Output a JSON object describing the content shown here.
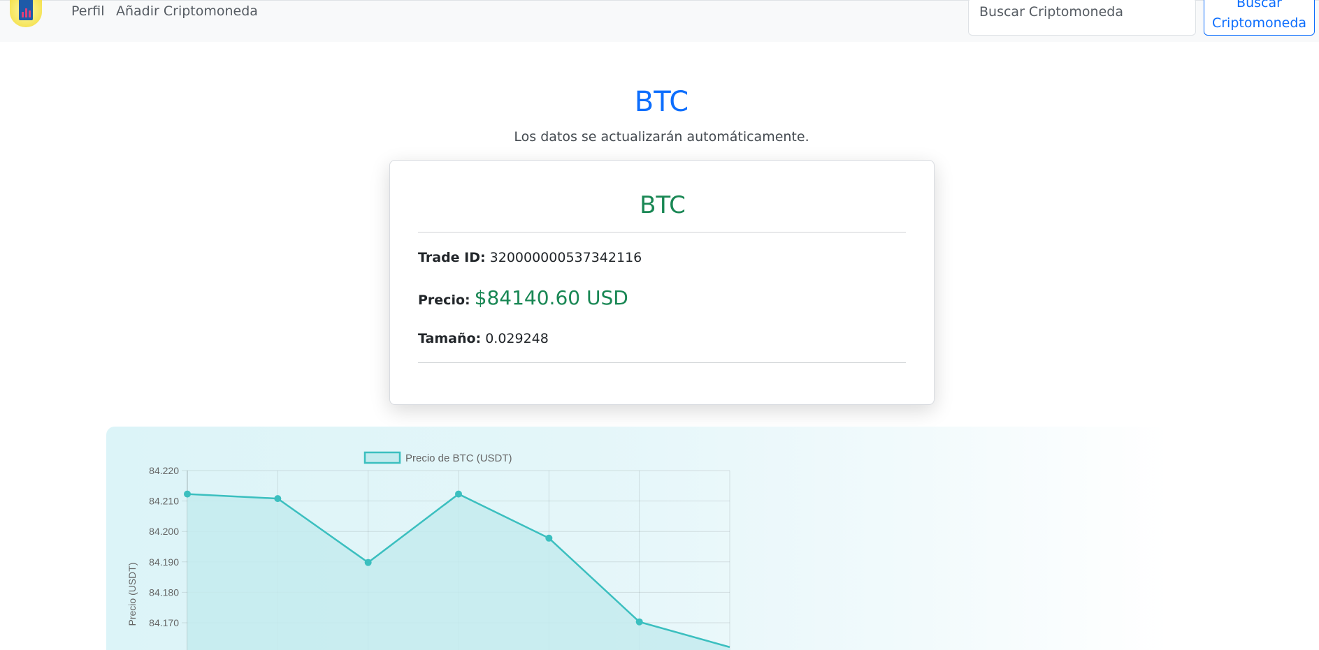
{
  "navbar": {
    "links": [
      "Perfil",
      "Añadir Criptomoneda"
    ],
    "search_placeholder": "Buscar Criptomoneda",
    "search_button": "Buscar Criptomoneda"
  },
  "header": {
    "title": "BTC",
    "subtitle": "Los datos se actualizarán automáticamente."
  },
  "card": {
    "symbol": "BTC",
    "trade_id_label": "Trade ID:",
    "trade_id": "320000000537342116",
    "price_label": "Precio:",
    "price": "$84140.60 USD",
    "size_label": "Tamaño:",
    "size": "0.029248"
  },
  "colors": {
    "primary": "#0d6efd",
    "success": "#198754",
    "chart_line": "#3bbfbf",
    "chart_fill": "#c4ebee"
  },
  "chart_data": {
    "type": "line",
    "legend": "Precio de BTC (USDT)",
    "legend_position": "top",
    "ylabel": "Precio (USDT)",
    "ylim": [
      84.16,
      84.22
    ],
    "yticks": [
      "84.220",
      "84.210",
      "84.200",
      "84.190",
      "84.180",
      "84.170"
    ],
    "grid": true,
    "series": [
      {
        "name": "Precio de BTC (USDT)",
        "values": [
          84.2123,
          84.2108,
          84.1898,
          84.2123,
          84.1978,
          84.1703,
          84.162
        ]
      }
    ]
  }
}
